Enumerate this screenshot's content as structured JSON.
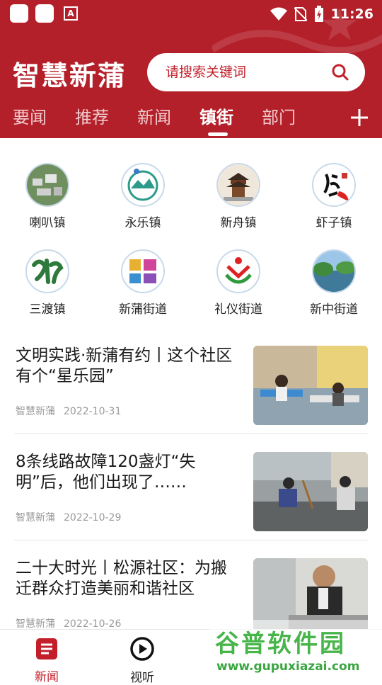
{
  "status_bar": {
    "time": "11:26",
    "app_badge": "A"
  },
  "header": {
    "title": "智慧新蒲",
    "search_placeholder": "请搜索关键词",
    "tabs": [
      {
        "label": "要闻",
        "active": false
      },
      {
        "label": "推荐",
        "active": false
      },
      {
        "label": "新闻",
        "active": false
      },
      {
        "label": "镇街",
        "active": true
      },
      {
        "label": "部门",
        "active": false
      }
    ]
  },
  "towns": [
    {
      "label": "喇叭镇",
      "icon": "town-photo-icon"
    },
    {
      "label": "永乐镇",
      "icon": "mountain-logo-icon"
    },
    {
      "label": "新舟镇",
      "icon": "pavilion-icon"
    },
    {
      "label": "虾子镇",
      "icon": "calligraphy-logo-icon"
    },
    {
      "label": "三渡镇",
      "icon": "green-logo-icon"
    },
    {
      "label": "新蒲街道",
      "icon": "colorful-logo-icon"
    },
    {
      "label": "礼仪街道",
      "icon": "people-logo-icon"
    },
    {
      "label": "新中街道",
      "icon": "lake-photo-icon"
    }
  ],
  "articles": [
    {
      "title": "文明实践·新蒲有约丨这个社区有个“星乐园”",
      "source": "智慧新蒲",
      "date": "2022-10-31",
      "thumb": "classroom-photo"
    },
    {
      "title": "8条线路故障120盏灯“失明”后，他们出现了……",
      "source": "智慧新蒲",
      "date": "2022-10-29",
      "thumb": "street-repair-photo"
    },
    {
      "title": "二十大时光丨松源社区：为搬迁群众打造美丽和谐社区",
      "source": "智慧新蒲",
      "date": "2022-10-26",
      "thumb": "man-portrait-photo"
    }
  ],
  "bottom_nav": [
    {
      "label": "新闻",
      "icon": "news-icon",
      "active": true
    },
    {
      "label": "视听",
      "icon": "play-icon",
      "active": false
    }
  ],
  "watermark": {
    "title": "谷普软件园",
    "url": "www.gupuxiazai.com"
  },
  "colors": {
    "brand_red": "#b3202a",
    "active_nav": "#c21f2a"
  }
}
